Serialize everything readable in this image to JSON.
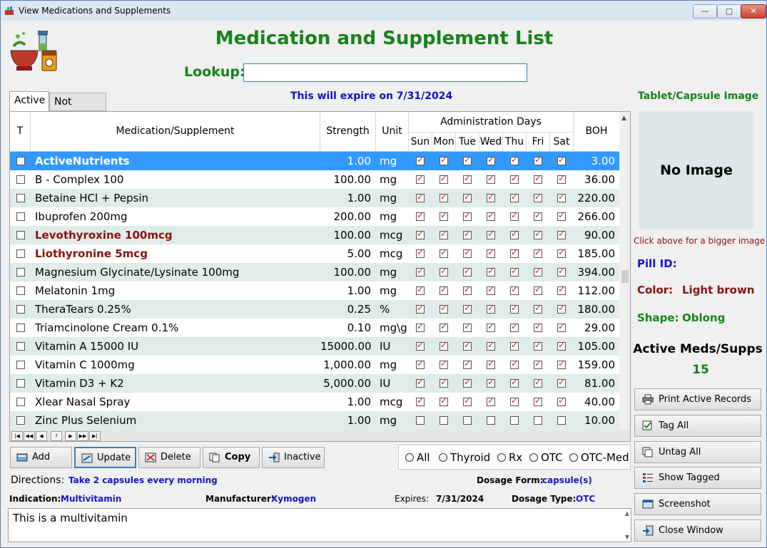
{
  "window": {
    "title": "View Medications and Supplements",
    "minimize": "—",
    "maximize": "▢",
    "close": "✕"
  },
  "heading": "Medication and Supplement List",
  "lookup": {
    "label": "Lookup:",
    "value": ""
  },
  "expiry_notice": "This will expire on  7/31/2024",
  "tabs": [
    {
      "label": "Active"
    },
    {
      "label": "Not Active"
    }
  ],
  "grid": {
    "columns": {
      "tag": "T",
      "name": "Medication/Supplement",
      "strength": "Strength",
      "unit": "Unit",
      "admin_days": "Administration Days",
      "days": [
        "Sun",
        "Mon",
        "Tue",
        "Wed",
        "Thu",
        "Fri",
        "Sat"
      ],
      "boh": "BOH"
    },
    "rows": [
      {
        "name": "ActiveNutrients",
        "strength": "1.00",
        "unit": "mg",
        "boh": "3.00",
        "bold": true,
        "color": "#ffffff",
        "days": [
          true,
          true,
          true,
          true,
          true,
          true,
          true
        ],
        "selected": true
      },
      {
        "name": "B - Complex 100",
        "strength": "100.00",
        "unit": "mg",
        "boh": "36.00",
        "bold": false,
        "color": "#000000",
        "days": [
          true,
          true,
          true,
          true,
          true,
          true,
          true
        ]
      },
      {
        "name": "Betaine HCl + Pepsin",
        "strength": "1.00",
        "unit": "mg",
        "boh": "220.00",
        "bold": false,
        "color": "#000000",
        "days": [
          true,
          true,
          true,
          true,
          true,
          true,
          true
        ]
      },
      {
        "name": "Ibuprofen 200mg",
        "strength": "200.00",
        "unit": "mg",
        "boh": "266.00",
        "bold": false,
        "color": "#000000",
        "days": [
          true,
          true,
          true,
          true,
          true,
          true,
          true
        ]
      },
      {
        "name": "Levothyroxine 100mcg",
        "strength": "100.00",
        "unit": "mcg",
        "boh": "90.00",
        "bold": true,
        "color": "#8b1010",
        "days": [
          true,
          true,
          true,
          true,
          true,
          true,
          true
        ]
      },
      {
        "name": "Liothyronine 5mcg",
        "strength": "5.00",
        "unit": "mcg",
        "boh": "185.00",
        "bold": true,
        "color": "#8b1010",
        "days": [
          true,
          true,
          true,
          true,
          true,
          true,
          true
        ]
      },
      {
        "name": "Magnesium Glycinate/Lysinate 100mg",
        "strength": "100.00",
        "unit": "mg",
        "boh": "394.00",
        "bold": false,
        "color": "#000000",
        "days": [
          true,
          true,
          true,
          true,
          true,
          true,
          true
        ]
      },
      {
        "name": "Melatonin 1mg",
        "strength": "1.00",
        "unit": "mg",
        "boh": "112.00",
        "bold": false,
        "color": "#000000",
        "days": [
          true,
          true,
          true,
          true,
          true,
          true,
          true
        ]
      },
      {
        "name": "TheraTears 0.25%",
        "strength": "0.25",
        "unit": "%",
        "boh": "180.00",
        "bold": false,
        "color": "#000000",
        "days": [
          true,
          true,
          true,
          true,
          true,
          true,
          true
        ]
      },
      {
        "name": "Triamcinolone Cream 0.1%",
        "strength": "0.10",
        "unit": "mg\\gm",
        "boh": "29.00",
        "bold": false,
        "color": "#000000",
        "days": [
          true,
          true,
          true,
          true,
          true,
          true,
          true
        ]
      },
      {
        "name": "Vitamin A 15000 IU",
        "strength": "15000.00",
        "unit": "IU",
        "boh": "105.00",
        "bold": false,
        "color": "#000000",
        "days": [
          true,
          true,
          true,
          true,
          true,
          true,
          true
        ]
      },
      {
        "name": "Vitamin C 1000mg",
        "strength": "1,000.00",
        "unit": "mg",
        "boh": "159.00",
        "bold": false,
        "color": "#000000",
        "days": [
          true,
          true,
          true,
          true,
          true,
          true,
          true
        ]
      },
      {
        "name": "Vitamin D3 + K2",
        "strength": "5,000.00",
        "unit": "IU",
        "boh": "81.00",
        "bold": false,
        "color": "#000000",
        "days": [
          true,
          true,
          true,
          true,
          true,
          true,
          true
        ]
      },
      {
        "name": "Xlear Nasal Spray",
        "strength": "1.00",
        "unit": "mcg",
        "boh": "40.00",
        "bold": false,
        "color": "#000000",
        "days": [
          true,
          true,
          true,
          true,
          true,
          true,
          true
        ]
      },
      {
        "name": "Zinc Plus Selenium",
        "strength": "1.00",
        "unit": "mg",
        "boh": "10.00",
        "bold": false,
        "color": "#000000",
        "days": [
          false,
          false,
          false,
          false,
          false,
          false,
          false
        ]
      }
    ]
  },
  "actions": {
    "add": "Add",
    "update": "Update",
    "delete": "Delete",
    "copy": "Copy",
    "inactive": "Inactive"
  },
  "filters": {
    "options": [
      "All",
      "Thyroid",
      "Rx",
      "OTC",
      "OTC-Med"
    ]
  },
  "details": {
    "directions_label": "Directions:",
    "directions_value": "Take 2 capsules every morning",
    "dosage_form_label": "Dosage Form:",
    "dosage_form_value": "capsule(s)",
    "indication_label": "Indication:",
    "indication_value": "Multivitamin",
    "manufacturer_label": "Manufacturer:",
    "manufacturer_value": "Xymogen",
    "expires_label": "Expires:",
    "expires_value": "7/31/2024",
    "dosage_type_label": "Dosage Type:",
    "dosage_type_value": "OTC",
    "notes": "This is a multivitamin"
  },
  "side": {
    "image_title": "Tablet/Capsule Image",
    "no_image": "No Image",
    "click_hint": "Click above for a bigger image",
    "pill_id_label": "Pill ID:",
    "color_label": "Color:",
    "color_value": "Light brown",
    "shape_label": "Shape:",
    "shape_value": "Oblong",
    "count_label": "Active Meds/Supps",
    "count_value": "15",
    "buttons": {
      "print": "Print Active Records",
      "tag_all": "Tag All",
      "untag_all": "Untag All",
      "show_tagged": "Show Tagged",
      "screenshot": "Screenshot",
      "close": "Close Window"
    }
  },
  "colors": {
    "heading_green": "#15831c",
    "link_blue": "#1515c8",
    "dark_red": "#8b1010",
    "selection_blue": "#3399ff",
    "alt_row": "#e0ece9"
  }
}
